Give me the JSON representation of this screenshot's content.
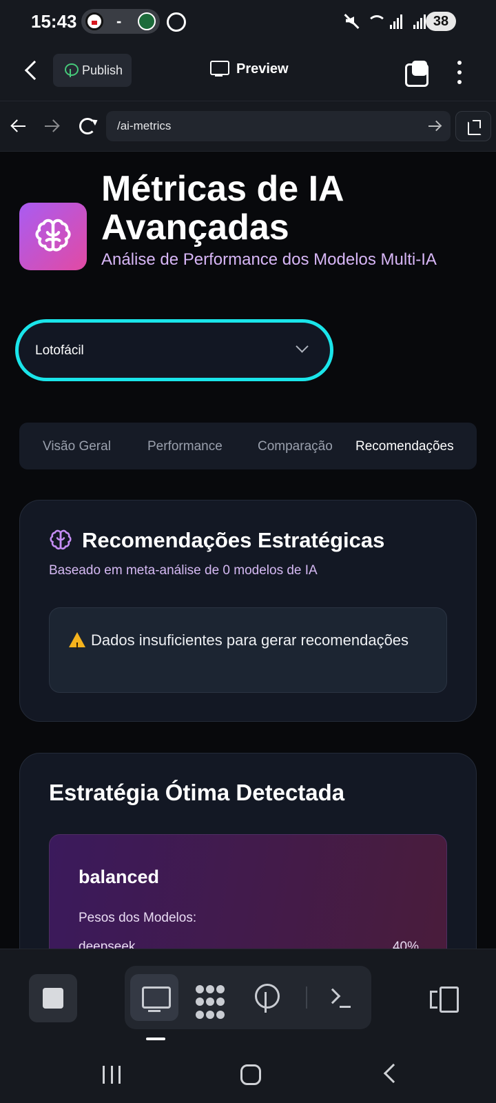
{
  "status_bar": {
    "time": "15:43",
    "score_separator": "-",
    "battery_level": "38",
    "icons": [
      "team-badge-icon",
      "team-badge-icon",
      "whatsapp-icon",
      "mute-icon",
      "wifi-icon",
      "signal-icon",
      "signal-icon"
    ]
  },
  "app_header": {
    "publish_label": "Publish",
    "preview_label": "Preview"
  },
  "url_bar": {
    "path": "/ai-metrics"
  },
  "page": {
    "title": "Métricas de IA Avançadas",
    "subtitle": "Análise de Performance dos Modelos Multi-IA",
    "accent_gradient": [
      "#a95cf2",
      "#e24aa3"
    ],
    "select": {
      "value": "Lotofácil",
      "focus_color": "#1ae5ea"
    },
    "tabs": [
      {
        "label": "Visão Geral",
        "active": false
      },
      {
        "label": "Performance",
        "active": false
      },
      {
        "label": "Comparação",
        "active": false
      },
      {
        "label": "Recomendações",
        "active": true
      }
    ],
    "recommendations_card": {
      "title": "Recomendações Estratégicas",
      "subtitle": "Baseado em meta-análise de 0 modelos de IA",
      "alert": "Dados insuficientes para gerar recomendações"
    },
    "strategy_card": {
      "title": "Estratégia Ótima Detectada",
      "strategy_name": "balanced",
      "weights_label": "Pesos dos Modelos:",
      "weights": [
        {
          "model": "deepseek",
          "percent": "40%"
        }
      ]
    }
  },
  "toolbar": {
    "tools": [
      "monitor-icon",
      "dots-grid-icon",
      "globe-deploy-icon",
      "terminal-icon"
    ],
    "active_tool": "monitor-icon"
  }
}
